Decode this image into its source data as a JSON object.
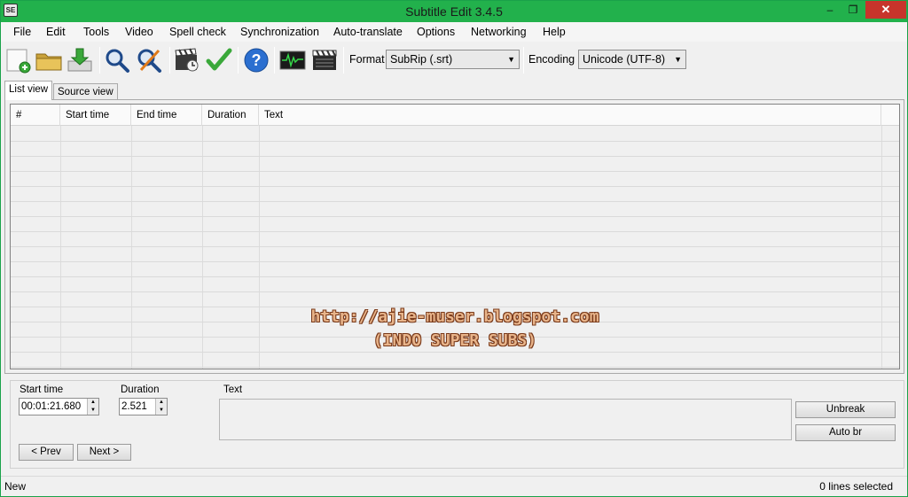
{
  "window": {
    "title": "Subtitle Edit 3.4.5",
    "app_icon": "SE",
    "minimize_glyph": "–",
    "maximize_glyph": "❐",
    "close_glyph": "✕"
  },
  "menu": [
    "File",
    "Edit",
    "Tools",
    "Video",
    "Spell check",
    "Synchronization",
    "Auto-translate",
    "Options",
    "Networking",
    "Help"
  ],
  "toolbar": {
    "icons": [
      "new-file-icon",
      "open-folder-icon",
      "save-download-icon",
      "find-icon",
      "replace-icon",
      "video-clapper-clock-icon",
      "checkmark-icon",
      "help-icon",
      "waveform-icon",
      "video-clapperboard-icon"
    ],
    "format_label": "Format",
    "format_value": "SubRip (.srt)",
    "encoding_label": "Encoding",
    "encoding_value": "Unicode (UTF-8)"
  },
  "tabs": [
    "List view",
    "Source view"
  ],
  "list": {
    "columns": [
      "#",
      "Start time",
      "End time",
      "Duration",
      "Text"
    ],
    "rows": []
  },
  "watermark": {
    "line1": "http://ajie-muser.blogspot.com",
    "line2": "(INDO SUPER SUBS)",
    "color": "#e8b48a"
  },
  "edit": {
    "start_time_label": "Start time",
    "start_time_value": "00:01:21.680",
    "duration_label": "Duration",
    "duration_value": "2.521",
    "text_label": "Text",
    "text_value": "",
    "unbreak_label": "Unbreak",
    "auto_br_label": "Auto br",
    "prev_label": "< Prev",
    "next_label": "Next >"
  },
  "status": {
    "left": "New",
    "right": "0 lines selected"
  }
}
